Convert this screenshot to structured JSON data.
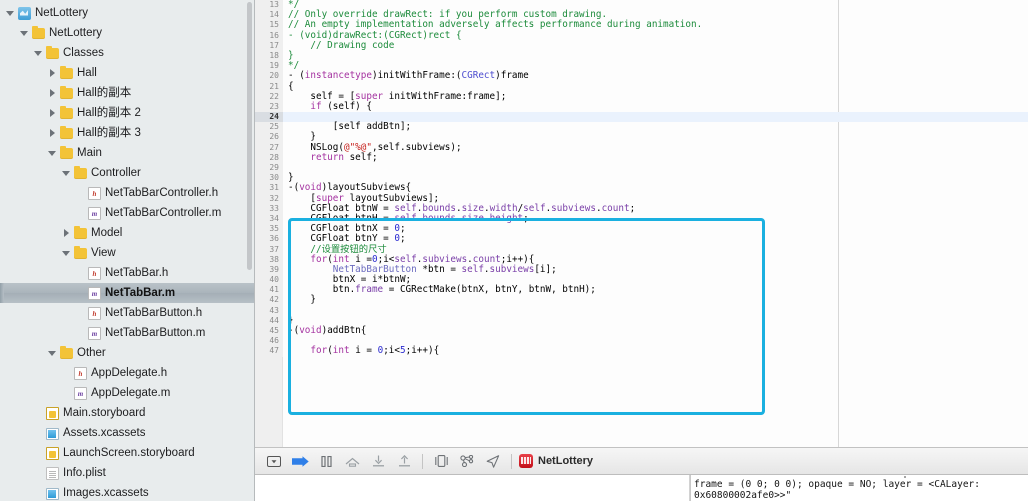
{
  "navigator": {
    "scrollbar": "vertical-scrollbar",
    "items": [
      {
        "label": "NetLottery",
        "depth": 0,
        "twist": "open",
        "icon": "project-icon"
      },
      {
        "label": "NetLottery",
        "depth": 1,
        "twist": "open",
        "icon": "folder-icon"
      },
      {
        "label": "Classes",
        "depth": 2,
        "twist": "open",
        "icon": "folder-icon"
      },
      {
        "label": "Hall",
        "depth": 3,
        "twist": "closed",
        "icon": "folder-icon"
      },
      {
        "label": "Hall的副本",
        "depth": 3,
        "twist": "closed",
        "icon": "folder-icon"
      },
      {
        "label": "Hall的副本 2",
        "depth": 3,
        "twist": "closed",
        "icon": "folder-icon"
      },
      {
        "label": "Hall的副本 3",
        "depth": 3,
        "twist": "closed",
        "icon": "folder-icon"
      },
      {
        "label": "Main",
        "depth": 3,
        "twist": "open",
        "icon": "folder-icon"
      },
      {
        "label": "Controller",
        "depth": 4,
        "twist": "open",
        "icon": "folder-icon"
      },
      {
        "label": "NetTabBarController.h",
        "depth": 5,
        "twist": "none",
        "icon": "header-file-icon"
      },
      {
        "label": "NetTabBarController.m",
        "depth": 5,
        "twist": "none",
        "icon": "implementation-file-icon"
      },
      {
        "label": "Model",
        "depth": 4,
        "twist": "closed",
        "icon": "folder-icon"
      },
      {
        "label": "View",
        "depth": 4,
        "twist": "open",
        "icon": "folder-icon"
      },
      {
        "label": "NetTabBar.h",
        "depth": 5,
        "twist": "none",
        "icon": "header-file-icon"
      },
      {
        "label": "NetTabBar.m",
        "depth": 5,
        "twist": "none",
        "icon": "implementation-file-icon",
        "selected": true
      },
      {
        "label": "NetTabBarButton.h",
        "depth": 5,
        "twist": "none",
        "icon": "header-file-icon"
      },
      {
        "label": "NetTabBarButton.m",
        "depth": 5,
        "twist": "none",
        "icon": "implementation-file-icon"
      },
      {
        "label": "Other",
        "depth": 3,
        "twist": "open",
        "icon": "folder-icon"
      },
      {
        "label": "AppDelegate.h",
        "depth": 4,
        "twist": "none",
        "icon": "header-file-icon"
      },
      {
        "label": "AppDelegate.m",
        "depth": 4,
        "twist": "none",
        "icon": "implementation-file-icon"
      },
      {
        "label": "Main.storyboard",
        "depth": 2,
        "twist": "none",
        "icon": "storyboard-icon"
      },
      {
        "label": "Assets.xcassets",
        "depth": 2,
        "twist": "none",
        "icon": "xcassets-icon"
      },
      {
        "label": "LaunchScreen.storyboard",
        "depth": 2,
        "twist": "none",
        "icon": "storyboard-icon"
      },
      {
        "label": "Info.plist",
        "depth": 2,
        "twist": "none",
        "icon": "plist-icon"
      },
      {
        "label": "Images.xcassets",
        "depth": 2,
        "twist": "none",
        "icon": "xcassets-icon"
      }
    ]
  },
  "editor": {
    "first_line_number": 13,
    "current_line": 24,
    "highlight_color": "#1ab0e0",
    "lines": [
      {
        "n": 13,
        "tokens": [
          {
            "t": "*/",
            "c": "cm"
          }
        ],
        "indent": 0,
        "partial": true
      },
      {
        "n": 14,
        "tokens": [
          {
            "t": "// Only override drawRect: if you perform custom drawing.",
            "c": "cm"
          }
        ],
        "indent": 0
      },
      {
        "n": 15,
        "tokens": [
          {
            "t": "// An empty implementation adversely affects performance during animation.",
            "c": "cm"
          }
        ],
        "indent": 0
      },
      {
        "n": 16,
        "tokens": [
          {
            "t": "- (",
            "c": "cm"
          },
          {
            "t": "void",
            "c": "cm"
          },
          {
            "t": ")drawRect:(",
            "c": "cm"
          },
          {
            "t": "CGRect",
            "c": "cm"
          },
          {
            "t": ")rect {",
            "c": "cm"
          }
        ],
        "indent": 0
      },
      {
        "n": 17,
        "tokens": [
          {
            "t": "    // Drawing code",
            "c": "cm"
          }
        ],
        "indent": 0
      },
      {
        "n": 18,
        "tokens": [
          {
            "t": "}",
            "c": "cm"
          }
        ],
        "indent": 0
      },
      {
        "n": 19,
        "tokens": [
          {
            "t": "*/",
            "c": "cm"
          }
        ],
        "indent": 0
      },
      {
        "n": 20,
        "tokens": [
          {
            "t": "- (",
            "c": "pl"
          },
          {
            "t": "instancetype",
            "c": "kw"
          },
          {
            "t": ")initWithFrame:(",
            "c": "pl"
          },
          {
            "t": "CGRect",
            "c": "ty"
          },
          {
            "t": ")frame",
            "c": "pl"
          }
        ],
        "indent": 0
      },
      {
        "n": 21,
        "tokens": [
          {
            "t": "{",
            "c": "pl"
          }
        ],
        "indent": 0
      },
      {
        "n": 22,
        "tokens": [
          {
            "t": "    self = [",
            "c": "pl"
          },
          {
            "t": "super",
            "c": "kw"
          },
          {
            "t": " initWithFrame:frame];",
            "c": "pl"
          }
        ],
        "indent": 0
      },
      {
        "n": 23,
        "tokens": [
          {
            "t": "    ",
            "c": "pl"
          },
          {
            "t": "if",
            "c": "kw"
          },
          {
            "t": " (self) {",
            "c": "pl"
          }
        ],
        "indent": 0
      },
      {
        "n": 24,
        "tokens": [],
        "indent": 0,
        "current": true
      },
      {
        "n": 25,
        "tokens": [
          {
            "t": "        [self addBtn];",
            "c": "pl"
          }
        ],
        "indent": 0
      },
      {
        "n": 26,
        "tokens": [
          {
            "t": "    }",
            "c": "pl"
          }
        ],
        "indent": 0
      },
      {
        "n": 27,
        "tokens": [
          {
            "t": "    NSLog(",
            "c": "pl"
          },
          {
            "t": "@\"%@\"",
            "c": "str"
          },
          {
            "t": ",self.subviews);",
            "c": "pl"
          }
        ],
        "indent": 0
      },
      {
        "n": 28,
        "tokens": [
          {
            "t": "    ",
            "c": "pl"
          },
          {
            "t": "return",
            "c": "kw"
          },
          {
            "t": " self;",
            "c": "pl"
          }
        ],
        "indent": 0
      },
      {
        "n": 29,
        "tokens": [],
        "indent": 0
      },
      {
        "n": 30,
        "tokens": [
          {
            "t": "}",
            "c": "pl"
          }
        ],
        "indent": 0
      },
      {
        "n": 31,
        "tokens": [
          {
            "t": "-(",
            "c": "pl"
          },
          {
            "t": "void",
            "c": "kw"
          },
          {
            "t": ")layoutSubviews{",
            "c": "pl"
          }
        ],
        "indent": 0
      },
      {
        "n": 32,
        "tokens": [
          {
            "t": "    [",
            "c": "pl"
          },
          {
            "t": "super",
            "c": "kw"
          },
          {
            "t": " layoutSubviews];",
            "c": "pl"
          }
        ],
        "indent": 0
      },
      {
        "n": 33,
        "tokens": [
          {
            "t": "    CGFloat btnW = ",
            "c": "pl"
          },
          {
            "t": "self",
            "c": "prp"
          },
          {
            "t": ".",
            "c": "pl"
          },
          {
            "t": "bounds",
            "c": "prp"
          },
          {
            "t": ".",
            "c": "pl"
          },
          {
            "t": "size",
            "c": "prp"
          },
          {
            "t": ".",
            "c": "pl"
          },
          {
            "t": "width",
            "c": "prp"
          },
          {
            "t": "/",
            "c": "pl"
          },
          {
            "t": "self",
            "c": "prp"
          },
          {
            "t": ".",
            "c": "pl"
          },
          {
            "t": "subviews",
            "c": "prp"
          },
          {
            "t": ".",
            "c": "pl"
          },
          {
            "t": "count",
            "c": "prp"
          },
          {
            "t": ";",
            "c": "pl"
          }
        ],
        "indent": 0
      },
      {
        "n": 34,
        "tokens": [
          {
            "t": "    CGFloat btnH = ",
            "c": "pl"
          },
          {
            "t": "self",
            "c": "prp"
          },
          {
            "t": ".",
            "c": "pl"
          },
          {
            "t": "bounds",
            "c": "prp"
          },
          {
            "t": ".",
            "c": "pl"
          },
          {
            "t": "size",
            "c": "prp"
          },
          {
            "t": ".",
            "c": "pl"
          },
          {
            "t": "height",
            "c": "prp"
          },
          {
            "t": ";",
            "c": "pl"
          }
        ],
        "indent": 0
      },
      {
        "n": 35,
        "tokens": [
          {
            "t": "    CGFloat btnX = ",
            "c": "pl"
          },
          {
            "t": "0",
            "c": "num"
          },
          {
            "t": ";",
            "c": "pl"
          }
        ],
        "indent": 0
      },
      {
        "n": 36,
        "tokens": [
          {
            "t": "    CGFloat btnY = ",
            "c": "pl"
          },
          {
            "t": "0",
            "c": "num"
          },
          {
            "t": ";",
            "c": "pl"
          }
        ],
        "indent": 0
      },
      {
        "n": 37,
        "tokens": [
          {
            "t": "    //设置按钮的尺寸",
            "c": "cm"
          }
        ],
        "indent": 0
      },
      {
        "n": 38,
        "tokens": [
          {
            "t": "    ",
            "c": "pl"
          },
          {
            "t": "for",
            "c": "kw"
          },
          {
            "t": "(",
            "c": "pl"
          },
          {
            "t": "int",
            "c": "kw"
          },
          {
            "t": " i =",
            "c": "pl"
          },
          {
            "t": "0",
            "c": "num"
          },
          {
            "t": ";i<",
            "c": "pl"
          },
          {
            "t": "self",
            "c": "prp"
          },
          {
            "t": ".",
            "c": "pl"
          },
          {
            "t": "subviews",
            "c": "prp"
          },
          {
            "t": ".",
            "c": "pl"
          },
          {
            "t": "count",
            "c": "prp"
          },
          {
            "t": ";i++){",
            "c": "pl"
          }
        ],
        "indent": 0
      },
      {
        "n": 39,
        "tokens": [
          {
            "t": "        ",
            "c": "pl"
          },
          {
            "t": "NetTabBarButton",
            "c": "cls"
          },
          {
            "t": " *btn = ",
            "c": "pl"
          },
          {
            "t": "self",
            "c": "prp"
          },
          {
            "t": ".",
            "c": "pl"
          },
          {
            "t": "subviews",
            "c": "prp"
          },
          {
            "t": "[i];",
            "c": "pl"
          }
        ],
        "indent": 0
      },
      {
        "n": 40,
        "tokens": [
          {
            "t": "        btnX = i*btnW;",
            "c": "pl"
          }
        ],
        "indent": 0
      },
      {
        "n": 41,
        "tokens": [
          {
            "t": "        btn.",
            "c": "pl"
          },
          {
            "t": "frame",
            "c": "prp"
          },
          {
            "t": " = CGRectMake(btnX, btnY, btnW, btnH);",
            "c": "pl"
          }
        ],
        "indent": 0
      },
      {
        "n": 42,
        "tokens": [
          {
            "t": "    }",
            "c": "pl"
          }
        ],
        "indent": 0
      },
      {
        "n": 43,
        "tokens": [],
        "indent": 0
      },
      {
        "n": 44,
        "tokens": [
          {
            "t": "}",
            "c": "pl"
          }
        ],
        "indent": 0
      },
      {
        "n": 45,
        "tokens": [
          {
            "t": "-(",
            "c": "pl"
          },
          {
            "t": "void",
            "c": "kw"
          },
          {
            "t": ")addBtn{",
            "c": "pl"
          }
        ],
        "indent": 0
      },
      {
        "n": 46,
        "tokens": [],
        "indent": 0
      },
      {
        "n": 47,
        "tokens": [
          {
            "t": "    ",
            "c": "pl"
          },
          {
            "t": "for",
            "c": "kw"
          },
          {
            "t": "(",
            "c": "pl"
          },
          {
            "t": "int",
            "c": "kw"
          },
          {
            "t": " i = ",
            "c": "pl"
          },
          {
            "t": "0",
            "c": "num"
          },
          {
            "t": ";i<",
            "c": "pl"
          },
          {
            "t": "5",
            "c": "num"
          },
          {
            "t": ";i++){",
            "c": "pl"
          }
        ],
        "indent": 0
      }
    ]
  },
  "debug_bar": {
    "buttons": [
      {
        "name": "hide-debug-area-button",
        "icon": "panel-toggle-icon",
        "active": false
      },
      {
        "name": "continue-button",
        "icon": "continue-arrow-icon",
        "active": true
      },
      {
        "name": "pause-button",
        "icon": "pause-icon",
        "active": false
      },
      {
        "name": "step-over-button",
        "icon": "step-over-icon",
        "active": false
      },
      {
        "name": "step-into-button",
        "icon": "step-into-icon",
        "active": false
      },
      {
        "name": "step-out-button",
        "icon": "step-out-icon",
        "active": false
      },
      {
        "name": "debug-view-hierarchy-button",
        "icon": "view-hierarchy-icon",
        "active": false
      },
      {
        "name": "debug-memory-graph-button",
        "icon": "memory-graph-icon",
        "active": false
      },
      {
        "name": "simulate-location-button",
        "icon": "location-arrow-icon",
        "active": false
      }
    ],
    "process_name": "NetLottery",
    "process_icon": "app-icon"
  },
  "console": {
    "variables_pane": "",
    "output_lines": [
      "frame = (0 0; 0 0); opaque = NO; layer = <CALayer:",
      "0x60800002afe0>>\""
    ]
  }
}
